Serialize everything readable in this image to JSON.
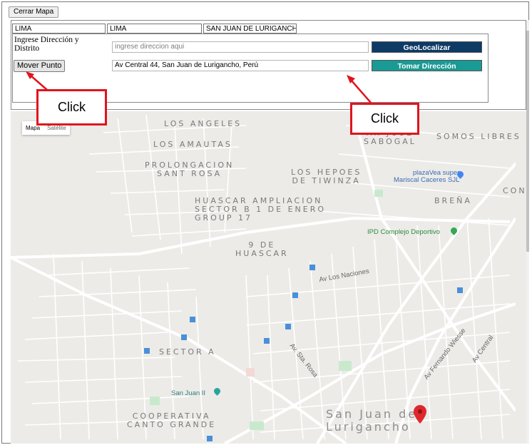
{
  "toolbar": {
    "close_label": "Cerrar Mapa"
  },
  "location": {
    "department": "LIMA",
    "province": "LIMA",
    "district": "SAN JUAN DE LURIGANCHO"
  },
  "form": {
    "address_label": "Ingrese Dirección y Distrito",
    "address_placeholder": "ingrese direccion aqui",
    "result_value": "Av Central 44, San Juan de Lurigancho, Perú",
    "move_point_label": "Mover Punto",
    "geolocate_label": "GeoLocalizar",
    "take_address_label": "Tomar Dirección"
  },
  "colors": {
    "geolocate_bg": "#0d3b66",
    "take_address_bg": "#1a9a94",
    "callout_border": "#e0141e",
    "marker": "#e0262d"
  },
  "map": {
    "type_control": {
      "map": "Mapa",
      "satellite": "Satélite"
    },
    "areas": [
      "LOS ANGELES",
      "LOS AMAUTAS",
      "PROLONGACION\nSANT ROSA",
      "LOS HEPOES\nDE TIWINZA",
      "AH JOSÉ\nSABOGAL",
      "HUASCAR AMPLIACION\nSECTOR B 1 DE ENERO\nGROUP 17",
      "9 DE\nHUASCAR",
      "SOMOS LIBRES",
      "BREÑA",
      "CON",
      "SECTOR A",
      "COOPERATIVA\nCANTO GRANDE"
    ],
    "district_name": "San Juan de\nLurigancho",
    "places": {
      "plaza_vea": "plazaVea super\nMariscal Caceres SJL",
      "ipd": "IPD Complejo Deportivo",
      "san_juan": "San Juan II"
    },
    "streets": [
      "Av Fernando Wiesse",
      "Av Central",
      "Av. Sta. Rosa",
      "Av Los Naciones"
    ]
  },
  "annotations": {
    "click_left": "Click",
    "click_right": "Click"
  }
}
